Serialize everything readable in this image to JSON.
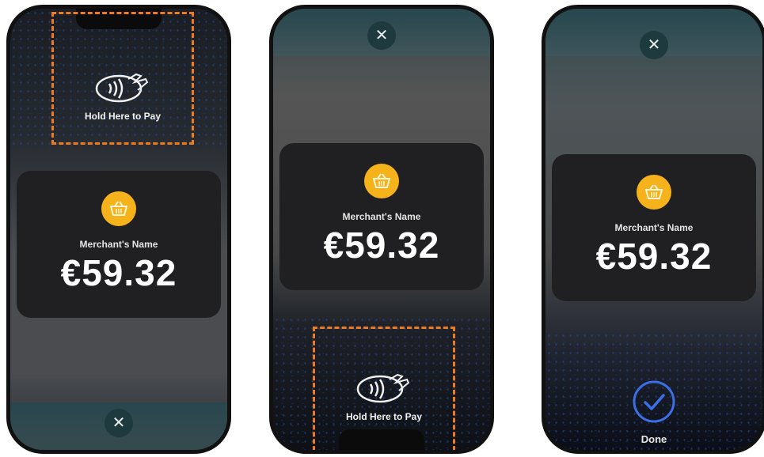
{
  "screens": [
    {
      "pay_label": "Hold Here to Pay",
      "merchant": "Merchant's Name",
      "amount": "€59.32",
      "close_glyph": "✕"
    },
    {
      "pay_label": "Hold Here to Pay",
      "merchant": "Merchant's Name",
      "amount": "€59.32",
      "close_glyph": "✕"
    },
    {
      "merchant": "Merchant's Name",
      "amount": "€59.32",
      "close_glyph": "✕",
      "done_label": "Done"
    }
  ],
  "colors": {
    "highlight_dash": "#f07a1c",
    "basket_badge": "#f6b21a",
    "done_check": "#3a6fe8"
  },
  "icons": [
    "nfc-contactless-icon",
    "basket-icon",
    "close-icon",
    "checkmark-circle-icon"
  ]
}
